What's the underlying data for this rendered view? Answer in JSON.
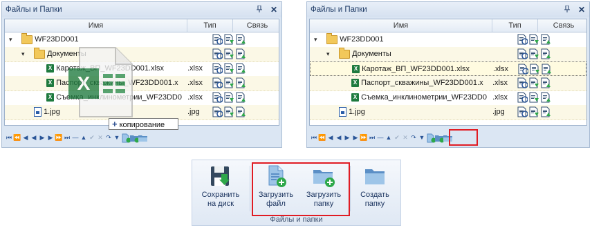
{
  "left_panel": {
    "title": "Файлы и Папки",
    "pin_icon": "pin-icon",
    "close_icon": "close-icon",
    "columns": {
      "name": "Имя",
      "type": "Тип",
      "link": "Связь"
    },
    "rows": [
      {
        "name": "WF23DD001",
        "ext": "",
        "kind": "folder",
        "level": 0,
        "expander": "▾"
      },
      {
        "name": "Документы",
        "ext": "",
        "kind": "folder",
        "level": 1,
        "expander": "▾"
      },
      {
        "name": "Каротаж_ВП_WF23DD001.xlsx",
        "ext": ".xlsx",
        "kind": "xlsx",
        "level": 2
      },
      {
        "name": "Паспорт_скважины_WF23DD001.x",
        "ext": ".xlsx",
        "kind": "xlsx",
        "level": 2
      },
      {
        "name": "Съемка_инклинометрии_WF23DD0",
        "ext": ".xlsx",
        "kind": "xlsx",
        "level": 2
      },
      {
        "name": "1.jpg",
        "ext": ".jpg",
        "kind": "jpg",
        "level": 1
      }
    ],
    "tooltip": {
      "plus": "+",
      "label": "копирование"
    }
  },
  "right_panel": {
    "title": "Файлы и Папки",
    "columns": {
      "name": "Имя",
      "type": "Тип",
      "link": "Связь"
    },
    "rows": [
      {
        "name": "WF23DD001",
        "ext": "",
        "kind": "folder",
        "level": 0,
        "expander": "▾"
      },
      {
        "name": "Документы",
        "ext": "",
        "kind": "folder",
        "level": 1,
        "expander": "▾"
      },
      {
        "name": "Каротаж_ВП_WF23DD001.xlsx",
        "ext": ".xlsx",
        "kind": "xlsx",
        "level": 2
      },
      {
        "name": "Паспорт_скважины_WF23DD001.x",
        "ext": ".xlsx",
        "kind": "xlsx",
        "level": 2
      },
      {
        "name": "Съемка_инклинометрии_WF23DD0",
        "ext": ".xlsx",
        "kind": "xlsx",
        "level": 2
      },
      {
        "name": "1.jpg",
        "ext": ".jpg",
        "kind": "jpg",
        "level": 1
      }
    ],
    "selected_row": 2
  },
  "navigator": {
    "buttons": [
      "⏮",
      "⏪",
      "◀",
      "◀",
      "▶",
      "▶",
      "⏩",
      "⏭",
      "—",
      "▲",
      "✔",
      "✕",
      "↷",
      "▼"
    ],
    "dim": [
      false,
      false,
      false,
      false,
      false,
      false,
      false,
      false,
      false,
      false,
      true,
      true,
      false,
      false
    ]
  },
  "ribbon": {
    "group_label": "Файлы и папки",
    "buttons": [
      {
        "id": "save",
        "line1": "Сохранить",
        "line2": "на диск",
        "icon": "floppy-save-icon"
      },
      {
        "id": "upload-file",
        "line1": "Загрузить",
        "line2": "файл",
        "icon": "upload-file-icon"
      },
      {
        "id": "upload-folder",
        "line1": "Загрузить",
        "line2": "папку",
        "icon": "upload-folder-icon"
      },
      {
        "id": "create-folder",
        "line1": "Создать",
        "line2": "папку",
        "icon": "create-folder-icon"
      }
    ]
  },
  "colors": {
    "highlight": "#e01c24",
    "accent": "#2a5597",
    "folder": "#f2c85a",
    "excel": "#1e7a3e"
  }
}
